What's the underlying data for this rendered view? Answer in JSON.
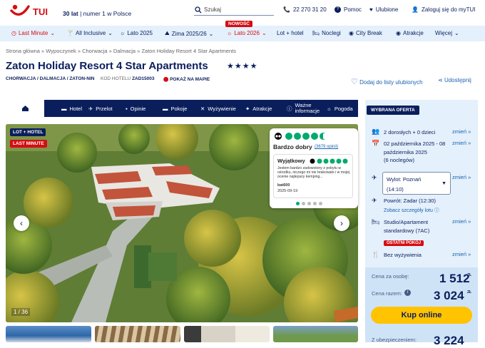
{
  "header": {
    "logo": "TUI",
    "tagline_bold": "30 lat",
    "tagline_rest": " | numer 1 w Polsce",
    "search_placeholder": "Szukaj",
    "phone": "22 270 31 20",
    "help": "Pomoc",
    "favorites": "Ulubione",
    "login": "Zaloguj się do myTUI"
  },
  "nav": {
    "items": [
      "Last Minute",
      "All Inclusive",
      "Lato 2025",
      "Zima 2025/26",
      "Lato 2026",
      "Lot + hotel",
      "Noclegi",
      "City Break",
      "Atrakcje",
      "Więcej"
    ],
    "new_badge": "NOWOŚĆ"
  },
  "breadcrumbs": "Strona główna » Wypoczynek » Chorwacja » Dalmacja » Zaton Holiday Resort 4 Star Apartments",
  "hotel": {
    "name": "Zaton Holiday Resort 4 Star Apartments",
    "stars": "★★★★",
    "location": "CHORWACJA / DALMACJA / ZATON-NIN",
    "code_label": "KOD HOTELU",
    "code": "ZAD15003",
    "map_link": "POKAŻ NA MAPIE",
    "add_fav": "Dodaj do listy ulubionych",
    "share": "Udostępnij"
  },
  "tabs": [
    "Hotel",
    "Przelot",
    "Opinie",
    "Pokoje",
    "Wyżywienie",
    "Atrakcje",
    "Ważne informacje",
    "Pogoda"
  ],
  "photo": {
    "badge1": "LOT + HOTEL",
    "badge2": "LAST MINUTE",
    "counter": "1 / 36"
  },
  "review": {
    "rating_label": "Bardzo dobry",
    "count": "(3679 opinii)",
    "headline": "Wyjątkowy",
    "text": "Jestem bardzo zadowolony z pobytu w ośrodku, niczego mi nie brakowało i w mojej ocenie najlepszy kemping...",
    "user": "bat600",
    "date": "2025-09-19"
  },
  "offer": {
    "tag": "WYBRANA OFERTA",
    "travelers": "2 dorosłych + 0 dzieci",
    "dates_line1": "02 października 2025 - 08",
    "dates_line2": "października 2025",
    "dates_line3": "(6 noclegów)",
    "departure_line1": "Wylot: Poznań",
    "departure_line2": "(14:10)",
    "return": "Powrót: Zadar (12:30)",
    "flight_details": "Zobacz szczegóły lotu",
    "room_line1": "Studio/Apartament",
    "room_line2": "standardowy (7AC)",
    "last_rooms": "OSTATNI POKÓJ",
    "board": "Bez wyżywienia",
    "change": "zmień »",
    "price_person_label": "Cena za osobę:",
    "price_person": "1 512",
    "price_total_label": "Cena razem:",
    "price_total": "3 024",
    "currency": "ZŁ",
    "buy": "Kup online",
    "insurance_label": "Z ubezpieczeniem:",
    "insurance_price": "3 224"
  },
  "colors": {
    "navy": "#0a1e5c",
    "red": "#d40e14",
    "light_blue": "#e4f0fb",
    "yellow": "#ffc300",
    "tripadvisor_green": "#00aa6c"
  }
}
